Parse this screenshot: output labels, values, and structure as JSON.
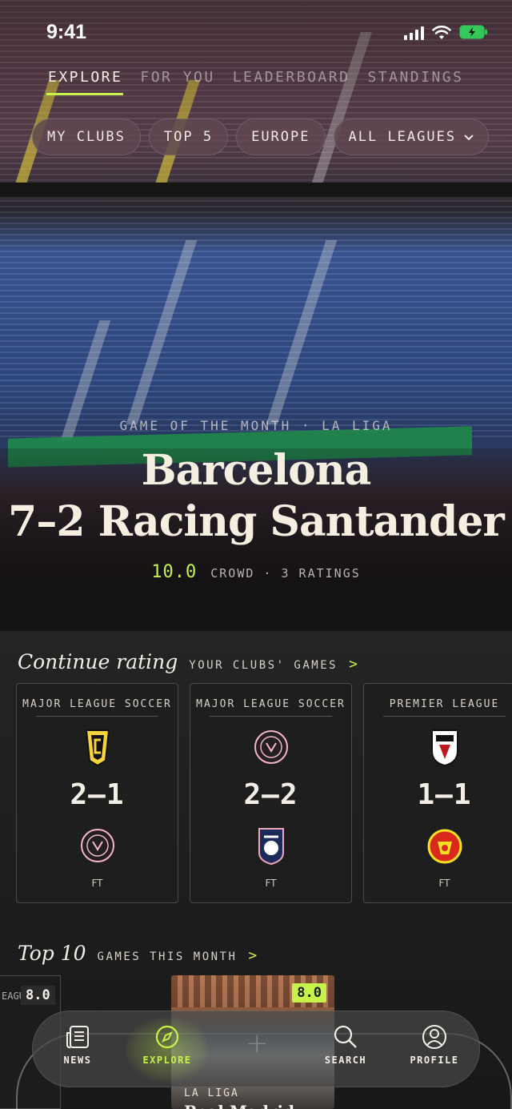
{
  "status_bar": {
    "time": "9:41"
  },
  "top_tabs": [
    {
      "label": "EXPLORE",
      "active": true
    },
    {
      "label": "FOR YOU",
      "active": false
    },
    {
      "label": "LEADERBOARD",
      "active": false
    },
    {
      "label": "STANDINGS",
      "active": false
    }
  ],
  "filters": [
    {
      "label": "MY CLUBS"
    },
    {
      "label": "TOP 5"
    },
    {
      "label": "EUROPE"
    },
    {
      "label": "ALL LEAGUES",
      "icon": "chevron-down-icon"
    }
  ],
  "hero": {
    "kicker": "GAME OF THE MONTH · LA LIGA",
    "title_line1": "Barcelona",
    "title_line2": "7–2 Racing Santander",
    "score": "10.0",
    "meta": "CROWD · 3 RATINGS"
  },
  "continue_rating": {
    "title": "Continue rating",
    "subtitle": "YOUR CLUBS' GAMES",
    "arrow": ">",
    "cards": [
      {
        "league": "MAJOR LEAGUE SOCCER",
        "score": "2–1",
        "status": "FT",
        "home_crest": "columbus-crew-crest",
        "away_crest": "inter-miami-crest"
      },
      {
        "league": "MAJOR LEAGUE SOCCER",
        "score": "2–2",
        "status": "FT",
        "home_crest": "inter-miami-crest",
        "away_crest": "san-diego-crest"
      },
      {
        "league": "PREMIER LEAGUE",
        "score": "1–1",
        "status": "FT",
        "home_crest": "fulham-crest",
        "away_crest": "manchester-united-crest"
      }
    ]
  },
  "top10": {
    "title": "Top 10",
    "subtitle": "GAMES THIS MONTH",
    "arrow": ">",
    "left_card": {
      "league_fragment": "EAGU",
      "rating": "8.0"
    },
    "main_card": {
      "rating": "8.0",
      "league": "LA LIGA",
      "title": "Real Madrid"
    }
  },
  "bottom_nav": [
    {
      "label": "NEWS",
      "icon": "news-icon"
    },
    {
      "label": "EXPLORE",
      "icon": "compass-icon",
      "active": true
    },
    {
      "label": "SEARCH",
      "icon": "search-icon"
    },
    {
      "label": "PROFILE",
      "icon": "profile-icon"
    }
  ],
  "colors": {
    "accent": "#c6f24a",
    "panel": "#1e1e1e",
    "chip": "#5f4650"
  }
}
